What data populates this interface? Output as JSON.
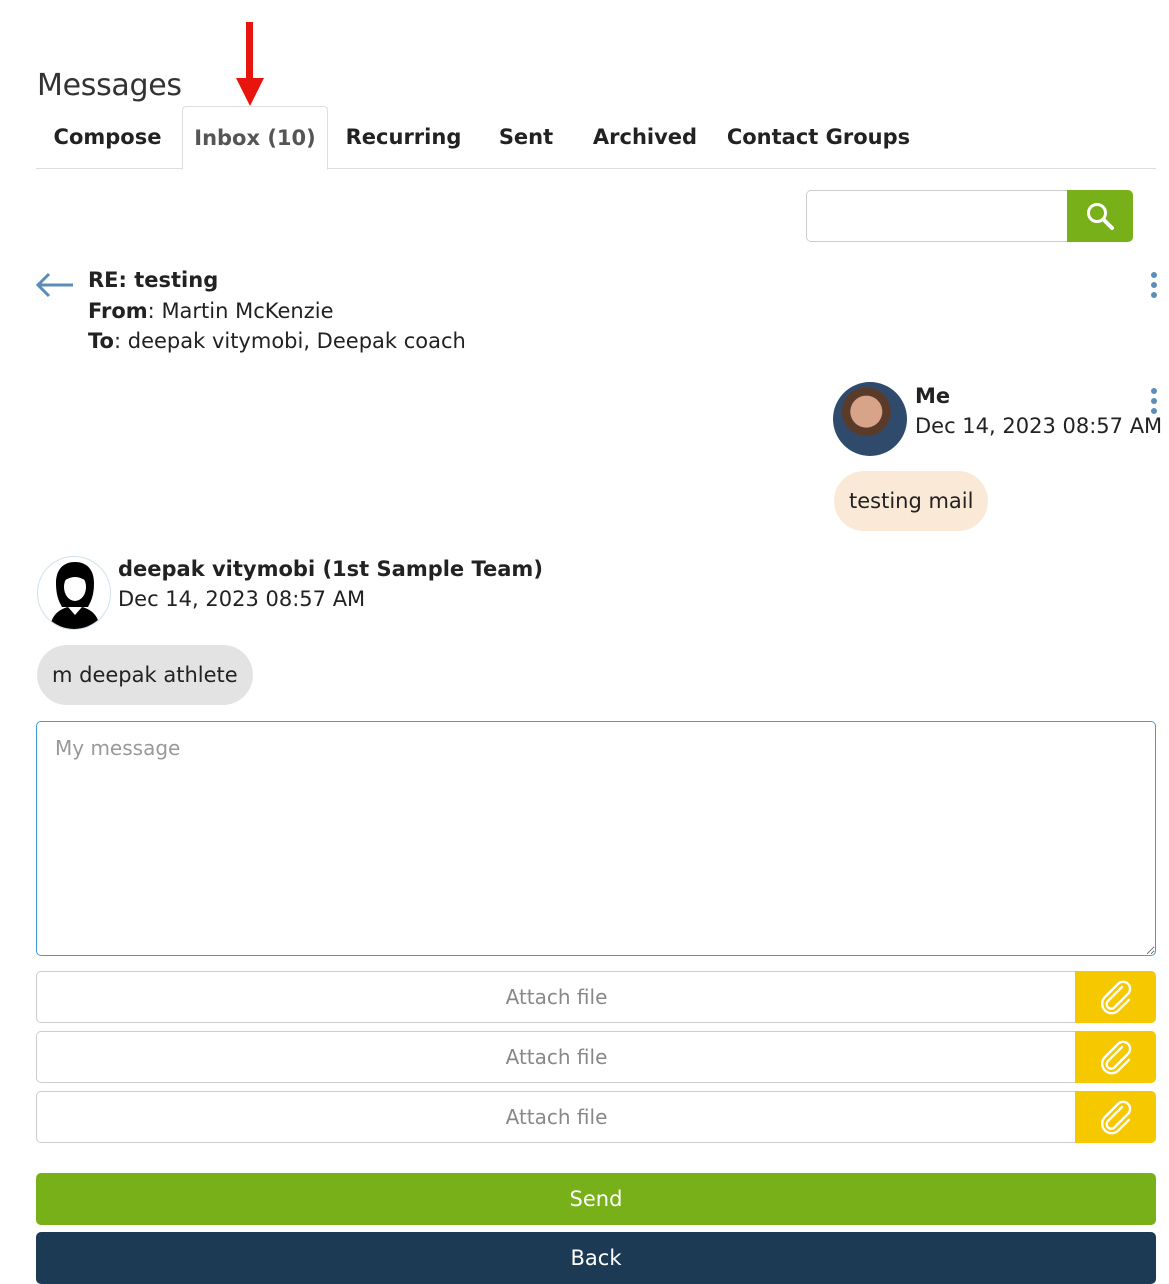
{
  "page": {
    "title": "Messages"
  },
  "tabs": [
    {
      "label": "Compose",
      "active": false
    },
    {
      "label": "Inbox (10)",
      "active": true
    },
    {
      "label": "Recurring",
      "active": false
    },
    {
      "label": "Sent",
      "active": false
    },
    {
      "label": "Archived",
      "active": false
    },
    {
      "label": "Contact Groups",
      "active": false
    }
  ],
  "search": {
    "placeholder": "",
    "icon": "search-icon"
  },
  "thread": {
    "subject": "RE: testing",
    "from_label": "From",
    "from_value": "Martin McKenzie",
    "to_label": "To",
    "to_value": "deepak vitymobi, Deepak coach"
  },
  "messages": [
    {
      "sender": "Me",
      "date": "Dec 14, 2023 08:57 AM",
      "text": "testing mail"
    },
    {
      "sender": "deepak vitymobi (1st Sample Team)",
      "date": "Dec 14, 2023 08:57 AM",
      "text": "m deepak athlete"
    }
  ],
  "compose": {
    "message_placeholder": "My message",
    "attach_label": "Attach file",
    "send_label": "Send",
    "back_label": "Back"
  },
  "colors": {
    "accent_green": "#78b01a",
    "attach_yellow": "#f5c800",
    "back_navy": "#1d3a55",
    "bubble_me": "#fae9d7",
    "bubble_other": "#e3e3e3",
    "annotation_red": "#e8140e"
  }
}
